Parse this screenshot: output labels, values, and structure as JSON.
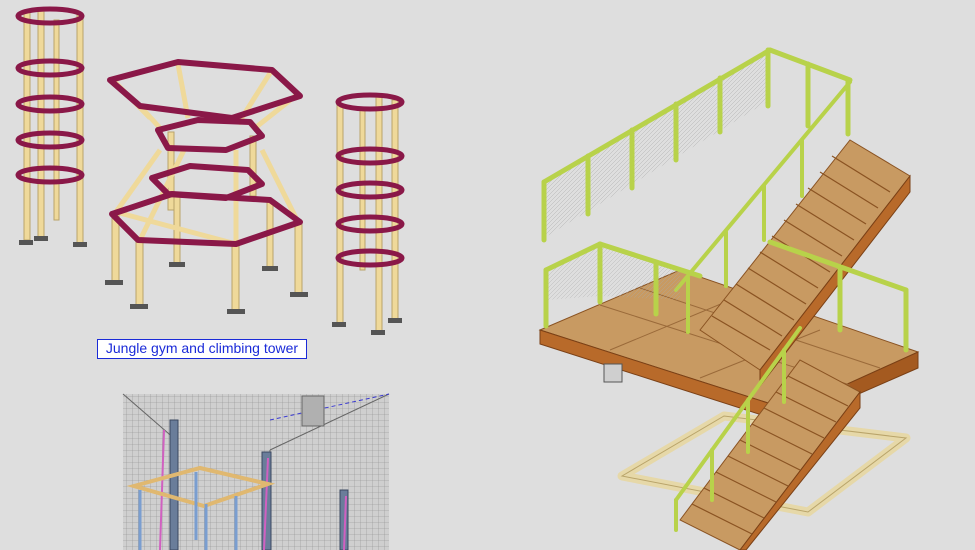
{
  "caption": {
    "text": "Jungle gym and climbing tower"
  },
  "colors": {
    "background": "#dedede",
    "post": "#efd99a",
    "post_edge": "#b9a46a",
    "ring": "#8a1848",
    "railing": "#b8d24a",
    "railing_edge": "#7f9624",
    "stair_steel": "#b86a2a",
    "stair_tread": "#c89a62",
    "platform_frame": "#e6d8a8",
    "mesh": "#9a9a9a",
    "caption_border": "#1a2ad8"
  },
  "figures": [
    {
      "name": "jungle gym",
      "icon": "jungle-gym-model"
    },
    {
      "name": "climbing tower",
      "icon": "climbing-tower-model"
    },
    {
      "name": "steel stair with railings",
      "icon": "stair-model"
    },
    {
      "name": "mesh enclosure detail",
      "icon": "mesh-detail-model"
    }
  ]
}
